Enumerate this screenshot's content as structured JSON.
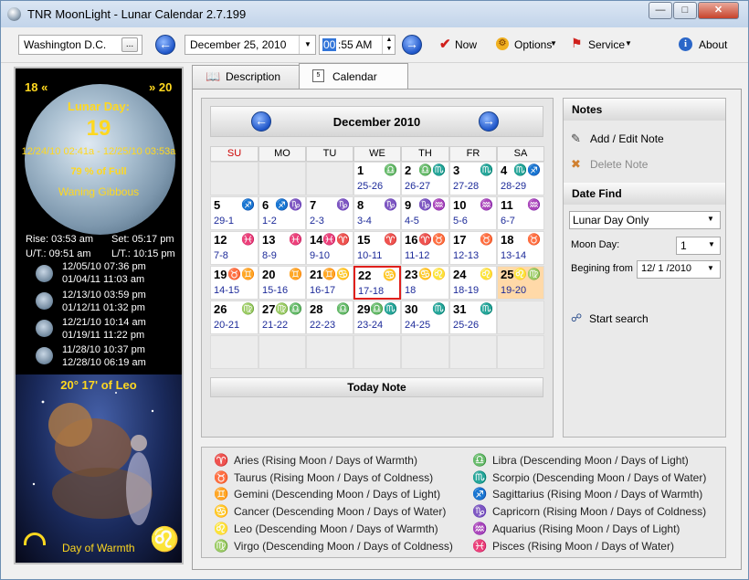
{
  "window": {
    "title": "TNR MoonLight - Lunar Calendar 2.7.199"
  },
  "toolbar": {
    "location": "Washington D.C.",
    "location_button": "...",
    "date": "December  25, 2010",
    "time_hour": "00",
    "time_rest": ":55 AM",
    "now_label": "Now",
    "options_label": "Options",
    "service_label": "Service",
    "about_label": "About"
  },
  "left_panel": {
    "prev_label": "18 «",
    "next_label": "» 20",
    "lunar_day_title": "Lunar Day:",
    "lunar_day": "19",
    "lunar_range": "12/24/10 02:41a - 12/25/10 03:53a",
    "full_pct": "79 % of Full",
    "phase_name": "Waning Gibbous",
    "rise": "Rise: 03:53 am",
    "set": "Set: 05:17 pm",
    "ut": "U/T.: 09:51 am",
    "lt": "L/T.: 10:15 pm",
    "phases": [
      {
        "line1": "12/05/10 07:36 pm",
        "line2": "01/04/11 11:03 am"
      },
      {
        "line1": "12/13/10 03:59 pm",
        "line2": "01/12/11 01:32 pm"
      },
      {
        "line1": "12/21/10 10:14 am",
        "line2": "01/19/11 11:22 pm"
      },
      {
        "line1": "11/28/10 10:37 pm",
        "line2": "12/28/10 06:19 am"
      }
    ],
    "zodiac_position": "20° 17' of Leo",
    "day_of": "Day of Warmth"
  },
  "tabs": [
    {
      "label": "Description"
    },
    {
      "label": "Calendar"
    }
  ],
  "calendar": {
    "month_title": "December 2010",
    "dow": [
      "SU",
      "MO",
      "TU",
      "WE",
      "TH",
      "FR",
      "SA"
    ],
    "today_note": "Today Note",
    "weeks": [
      [
        {
          "n": "",
          "s": "",
          "d": ""
        },
        {
          "n": "",
          "s": "",
          "d": ""
        },
        {
          "n": "",
          "s": "",
          "d": ""
        },
        {
          "n": "1",
          "s": "♎",
          "d": "25-26"
        },
        {
          "n": "2",
          "s": "♎♏",
          "d": "26-27"
        },
        {
          "n": "3",
          "s": "♏",
          "d": "27-28"
        },
        {
          "n": "4",
          "s": "♏♐",
          "d": "28-29"
        }
      ],
      [
        {
          "n": "5",
          "s": "♐",
          "d": "29-1"
        },
        {
          "n": "6",
          "s": "♐♑",
          "d": "1-2"
        },
        {
          "n": "7",
          "s": "♑",
          "d": "2-3"
        },
        {
          "n": "8",
          "s": "♑",
          "d": "3-4"
        },
        {
          "n": "9",
          "s": "♑♒",
          "d": "4-5"
        },
        {
          "n": "10",
          "s": "♒",
          "d": "5-6"
        },
        {
          "n": "11",
          "s": "♒",
          "d": "6-7"
        }
      ],
      [
        {
          "n": "12",
          "s": "♓",
          "d": "7-8"
        },
        {
          "n": "13",
          "s": "♓",
          "d": "8-9"
        },
        {
          "n": "14",
          "s": "♓♈",
          "d": "9-10"
        },
        {
          "n": "15",
          "s": "♈",
          "d": "10-11"
        },
        {
          "n": "16",
          "s": "♈♉",
          "d": "11-12"
        },
        {
          "n": "17",
          "s": "♉",
          "d": "12-13"
        },
        {
          "n": "18",
          "s": "♉",
          "d": "13-14"
        }
      ],
      [
        {
          "n": "19",
          "s": "♉♊",
          "d": "14-15"
        },
        {
          "n": "20",
          "s": "♊",
          "d": "15-16"
        },
        {
          "n": "21",
          "s": "♊♋",
          "d": "16-17"
        },
        {
          "n": "22",
          "s": "♋",
          "d": "17-18"
        },
        {
          "n": "23",
          "s": "♋♌",
          "d": "18"
        },
        {
          "n": "24",
          "s": "♌",
          "d": "18-19"
        },
        {
          "n": "25",
          "s": "♌♍",
          "d": "19-20"
        }
      ],
      [
        {
          "n": "26",
          "s": "♍",
          "d": "20-21"
        },
        {
          "n": "27",
          "s": "♍♎",
          "d": "21-22"
        },
        {
          "n": "28",
          "s": "♎",
          "d": "22-23"
        },
        {
          "n": "29",
          "s": "♎♏",
          "d": "23-24"
        },
        {
          "n": "30",
          "s": "♏",
          "d": "24-25"
        },
        {
          "n": "31",
          "s": "♏",
          "d": "25-26"
        },
        {
          "n": "",
          "s": "",
          "d": ""
        }
      ],
      [
        {
          "n": "",
          "s": "",
          "d": ""
        },
        {
          "n": "",
          "s": "",
          "d": ""
        },
        {
          "n": "",
          "s": "",
          "d": ""
        },
        {
          "n": "",
          "s": "",
          "d": ""
        },
        {
          "n": "",
          "s": "",
          "d": ""
        },
        {
          "n": "",
          "s": "",
          "d": ""
        },
        {
          "n": "",
          "s": "",
          "d": ""
        }
      ]
    ]
  },
  "notes": {
    "header": "Notes",
    "add_edit": "Add / Edit Note",
    "delete": "Delete Note"
  },
  "date_find": {
    "header": "Date Find",
    "mode": "Lunar Day Only",
    "moon_day_label": "Moon Day:",
    "moon_day_value": "1",
    "begin_label": "Begining from",
    "begin_value": "12/ 1 /2010",
    "start_search": "Start search"
  },
  "legend": [
    {
      "glyph": "♈",
      "text": "Aries (Rising Moon / Days of Warmth)"
    },
    {
      "glyph": "♉",
      "text": "Taurus (Rising Moon / Days of Coldness)"
    },
    {
      "glyph": "♊",
      "text": "Gemini (Descending Moon / Days of Light)"
    },
    {
      "glyph": "♋",
      "text": "Cancer (Descending Moon / Days of Water)"
    },
    {
      "glyph": "♌",
      "text": "Leo (Descending Moon / Days of Warmth)"
    },
    {
      "glyph": "♍",
      "text": "Virgo (Descending Moon / Days of Coldness)"
    },
    {
      "glyph": "♎",
      "text": "Libra (Descending Moon / Days of Light)"
    },
    {
      "glyph": "♏",
      "text": "Scorpio (Descending Moon / Days of Water)"
    },
    {
      "glyph": "♐",
      "text": "Sagittarius (Rising Moon / Days of Warmth)"
    },
    {
      "glyph": "♑",
      "text": "Capricorn (Rising Moon / Days of Coldness)"
    },
    {
      "glyph": "♒",
      "text": "Aquarius (Rising Moon / Days of Light)"
    },
    {
      "glyph": "♓",
      "text": "Pisces (Rising Moon / Days of Water)"
    }
  ],
  "colors": {
    "accent": "#1f56c9",
    "sunday": "#cc0000",
    "today_border": "#e0201c",
    "weekend_highlight": "#ffd9a8",
    "moon_text": "#ffd81f"
  }
}
